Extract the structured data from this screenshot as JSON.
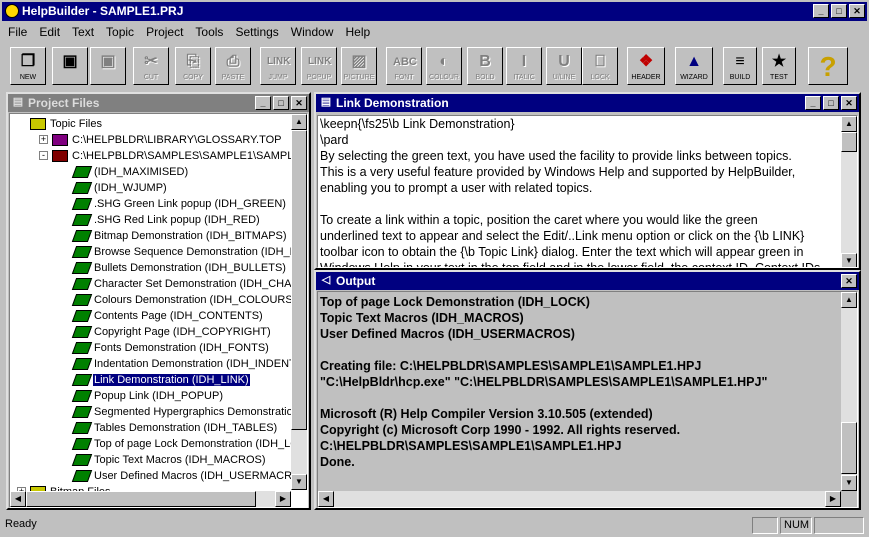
{
  "app": {
    "title": "HelpBuilder - SAMPLE1.PRJ"
  },
  "menu": [
    "File",
    "Edit",
    "Text",
    "Topic",
    "Project",
    "Tools",
    "Settings",
    "Window",
    "Help"
  ],
  "toolbar": [
    {
      "label": "NEW",
      "glyph": "❐",
      "enabled": true
    },
    {
      "label": "",
      "glyph": "▣",
      "enabled": true
    },
    {
      "label": "",
      "glyph": "▣",
      "enabled": false
    },
    {
      "label": "CUT",
      "glyph": "✂",
      "enabled": false
    },
    {
      "label": "COPY",
      "glyph": "⎘",
      "enabled": false
    },
    {
      "label": "PASTE",
      "glyph": "⎙",
      "enabled": false
    },
    {
      "label": "JUMP",
      "glyph": "LINK",
      "enabled": false
    },
    {
      "label": "POPUP",
      "glyph": "LINK",
      "enabled": false
    },
    {
      "label": "PICTURE",
      "glyph": "▨",
      "enabled": false
    },
    {
      "label": "FONT",
      "glyph": "ABC",
      "enabled": false
    },
    {
      "label": "COLOUR",
      "glyph": "◐",
      "enabled": false
    },
    {
      "label": "BOLD",
      "glyph": "B",
      "enabled": false
    },
    {
      "label": "ITALIC",
      "glyph": "I",
      "enabled": false
    },
    {
      "label": "U/LINE",
      "glyph": "U",
      "enabled": false
    },
    {
      "label": "LOCK",
      "glyph": "⎕",
      "enabled": false
    },
    {
      "label": "HEADER",
      "glyph": "❖",
      "enabled": true
    },
    {
      "label": "WIZARD",
      "glyph": "▲",
      "enabled": true
    },
    {
      "label": "BUILD",
      "glyph": "≡",
      "enabled": true
    },
    {
      "label": "TEST",
      "glyph": "★",
      "enabled": true
    },
    {
      "label": "",
      "glyph": "?",
      "enabled": true
    }
  ],
  "project": {
    "title": "Project Files",
    "nodes": [
      {
        "text": "Topic Files",
        "level": 0,
        "icon": "folder-open"
      },
      {
        "text": "C:\\HELPBLDR\\LIBRARY\\GLOSSARY.TOP",
        "level": 1,
        "icon": "book-closed",
        "expander": "+"
      },
      {
        "text": "C:\\HELPBLDR\\SAMPLES\\SAMPLE1\\SAMPLE1",
        "level": 1,
        "icon": "book-open",
        "expander": "-"
      },
      {
        "text": "(IDH_MAXIMISED)",
        "level": 2,
        "icon": "page-green"
      },
      {
        "text": "(IDH_WJUMP)",
        "level": 2,
        "icon": "page-green"
      },
      {
        "text": ".SHG Green Link popup (IDH_GREEN)",
        "level": 2,
        "icon": "page-green"
      },
      {
        "text": ".SHG Red Link popup (IDH_RED)",
        "level": 2,
        "icon": "page-green"
      },
      {
        "text": "Bitmap Demonstration (IDH_BITMAPS)",
        "level": 2,
        "icon": "page-green"
      },
      {
        "text": "Browse Sequence Demonstration (IDH_BROWSE)",
        "level": 2,
        "icon": "page-green"
      },
      {
        "text": "Bullets Demonstration (IDH_BULLETS)",
        "level": 2,
        "icon": "page-green"
      },
      {
        "text": "Character Set Demonstration (IDH_CHARSET)",
        "level": 2,
        "icon": "page-green"
      },
      {
        "text": "Colours Demonstration (IDH_COLOURS)",
        "level": 2,
        "icon": "page-green"
      },
      {
        "text": "Contents Page (IDH_CONTENTS)",
        "level": 2,
        "icon": "page-green"
      },
      {
        "text": "Copyright Page (IDH_COPYRIGHT)",
        "level": 2,
        "icon": "page-green"
      },
      {
        "text": "Fonts Demonstration (IDH_FONTS)",
        "level": 2,
        "icon": "page-green"
      },
      {
        "text": "Indentation Demonstration (IDH_INDENT)",
        "level": 2,
        "icon": "page-green"
      },
      {
        "text": "Link Demonstration (IDH_LINK)",
        "level": 2,
        "icon": "page-open",
        "selected": true
      },
      {
        "text": "Popup Link (IDH_POPUP)",
        "level": 2,
        "icon": "page-green"
      },
      {
        "text": "Segmented Hypergraphics Demonstration",
        "level": 2,
        "icon": "page-green"
      },
      {
        "text": "Tables Demonstration (IDH_TABLES)",
        "level": 2,
        "icon": "page-green"
      },
      {
        "text": "Top of page Lock Demonstration (IDH_LOCK)",
        "level": 2,
        "icon": "page-green"
      },
      {
        "text": "Topic Text Macros (IDH_MACROS)",
        "level": 2,
        "icon": "page-green"
      },
      {
        "text": "User Defined Macros (IDH_USERMACROS)",
        "level": 2,
        "icon": "page-green"
      },
      {
        "text": "Bitmap Files",
        "level": 0,
        "icon": "folder",
        "expander": "+"
      }
    ]
  },
  "editor": {
    "title": "Link Demonstration",
    "lines": [
      "\\keepn{\\fs25\\b Link Demonstration}",
      "\\pard",
      "By selecting the green text, you have used the facility to provide links between topics.",
      "This is a very useful feature provided by Windows Help and supported by HelpBuilder,",
      "enabling you to prompt a user with related topics.",
      "",
      "To create a link within a topic, position the caret where you would like the green",
      "underlined text to appear and select the Edit/..Link menu option or click on the {\\b LINK}",
      "toolbar icon to obtain the {\\b Topic Link} dialog. Enter the text which will appear green in",
      "Windows Help in your text in the top field and in the lower field, the context ID. Context IDs"
    ]
  },
  "output": {
    "title": "Output",
    "lines": [
      "Top of page Lock Demonstration (IDH_LOCK)",
      "Topic Text Macros (IDH_MACROS)",
      "User Defined Macros (IDH_USERMACROS)",
      "",
      "Creating file: C:\\HELPBLDR\\SAMPLES\\SAMPLE1\\SAMPLE1.HPJ",
      "\"C:\\HelpBldr\\hcp.exe\" \"C:\\HELPBLDR\\SAMPLES\\SAMPLE1\\SAMPLE1.HPJ\"",
      "",
      "Microsoft (R) Help Compiler Version 3.10.505 (extended)",
      "Copyright (c) Microsoft Corp 1990 - 1992. All rights reserved.",
      "C:\\HELPBLDR\\SAMPLES\\SAMPLE1\\SAMPLE1.HPJ",
      "Done."
    ]
  },
  "status": {
    "text": "Ready",
    "num": "NUM"
  }
}
